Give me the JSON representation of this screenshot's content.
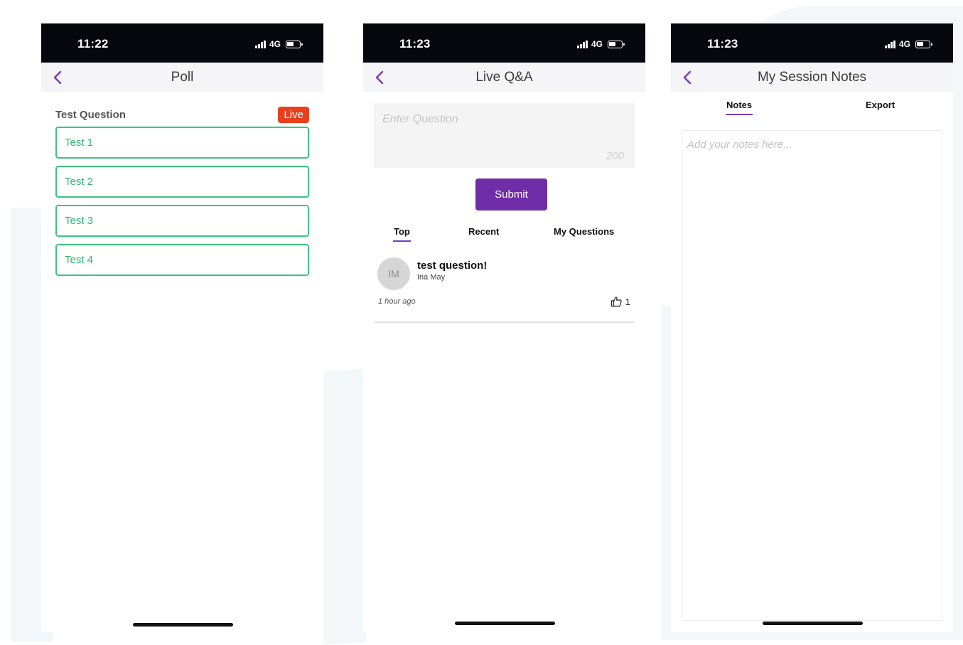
{
  "colors": {
    "accent_purple": "#6f2da8",
    "poll_green": "#3cc57d",
    "live_red": "#e8401c",
    "status_bar_black": "#07080d"
  },
  "poll_screen": {
    "status": {
      "time": "11:22",
      "network": "4G"
    },
    "nav": {
      "title": "Poll",
      "back_icon": "chevron-left-icon"
    },
    "question": "Test Question",
    "live_badge": "Live",
    "options": [
      {
        "label": "Test 1"
      },
      {
        "label": "Test 2"
      },
      {
        "label": "Test 3"
      },
      {
        "label": "Test 4"
      }
    ]
  },
  "qa_screen": {
    "status": {
      "time": "11:23",
      "network": "4G"
    },
    "nav": {
      "title": "Live Q&A",
      "back_icon": "chevron-left-icon"
    },
    "input": {
      "placeholder": "Enter Question",
      "char_limit": "200"
    },
    "submit_label": "Submit",
    "tabs": [
      {
        "label": "Top",
        "active": true
      },
      {
        "label": "Recent",
        "active": false
      },
      {
        "label": "My Questions",
        "active": false
      }
    ],
    "questions": [
      {
        "avatar_initials": "IM",
        "text": "test question!",
        "author": "Ina May",
        "time": "1 hour ago",
        "likes": "1",
        "like_icon": "thumbs-up-icon"
      }
    ]
  },
  "notes_screen": {
    "status": {
      "time": "11:23",
      "network": "4G"
    },
    "nav": {
      "title": "My Session Notes",
      "back_icon": "chevron-left-icon"
    },
    "tabs": [
      {
        "label": "Notes",
        "active": true
      },
      {
        "label": "Export",
        "active": false
      }
    ],
    "notes_placeholder": "Add your notes here..."
  }
}
